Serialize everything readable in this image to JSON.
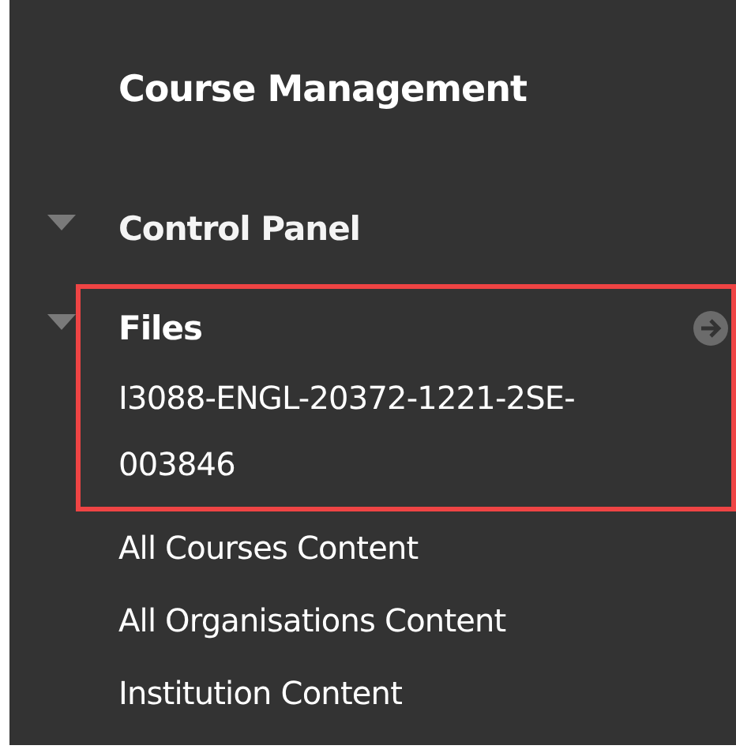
{
  "heading": "Course Management",
  "sections": [
    {
      "label": "Control Panel",
      "expanded": true,
      "highlighted": false
    },
    {
      "label": "Files",
      "expanded": true,
      "highlighted": true,
      "children": [
        {
          "label": "I3088-ENGL-20372-1221-2SE-003846",
          "highlighted": true
        },
        {
          "label": "All Courses Content",
          "highlighted": false
        },
        {
          "label": "All Organisations Content",
          "highlighted": false
        },
        {
          "label": "Institution Content",
          "highlighted": false
        }
      ]
    }
  ]
}
